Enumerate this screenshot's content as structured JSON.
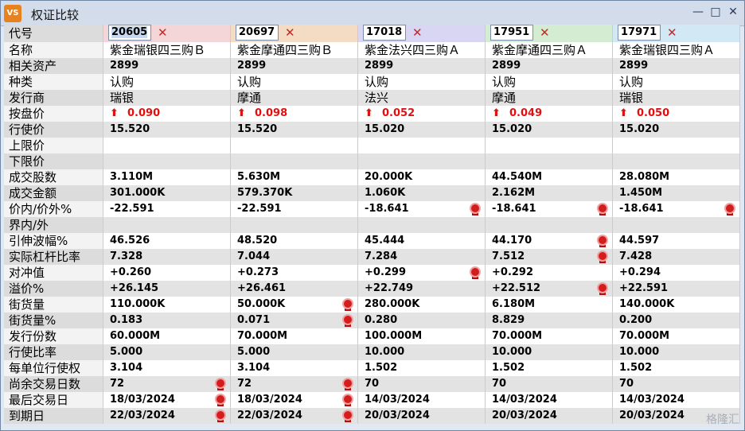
{
  "window": {
    "title": "权证比较",
    "app_icon": "VS",
    "controls": {
      "minimize": "—",
      "restore": "□",
      "close": "✕"
    }
  },
  "header": {
    "label": "代号",
    "codes": [
      "20605",
      "20697",
      "17018",
      "17951",
      "17971"
    ],
    "col_colors": [
      "#f4d6d8",
      "#f3dcc3",
      "#d8d6f2",
      "#d4ecd2",
      "#d3e8f5"
    ],
    "remove_icon": "✕"
  },
  "rows": [
    {
      "label": "名称",
      "values": [
        "紫金瑞银四三购Ｂ",
        "紫金摩通四三购Ｂ",
        "紫金法兴四三购Ａ",
        "紫金摩通四三购Ａ",
        "紫金瑞银四三购Ａ"
      ],
      "cn": true
    },
    {
      "label": "相关资产",
      "values": [
        "2899",
        "2899",
        "2899",
        "2899",
        "2899"
      ]
    },
    {
      "label": "种类",
      "values": [
        "认购",
        "认购",
        "认购",
        "认购",
        "认购"
      ],
      "cn": true
    },
    {
      "label": "发行商",
      "values": [
        "瑞银",
        "摩通",
        "法兴",
        "摩通",
        "瑞银"
      ],
      "cn": true
    },
    {
      "label": "按盘价",
      "values": [
        "0.090",
        "0.098",
        "0.052",
        "0.049",
        "0.050"
      ],
      "arrow": true
    },
    {
      "label": "行使价",
      "values": [
        "15.520",
        "15.520",
        "15.020",
        "15.020",
        "15.020"
      ]
    },
    {
      "label": "上限价",
      "values": [
        "",
        "",
        "",
        "",
        ""
      ]
    },
    {
      "label": "下限价",
      "values": [
        "",
        "",
        "",
        "",
        ""
      ]
    },
    {
      "label": "成交股数",
      "values": [
        "3.110M",
        "5.630M",
        "20.000K",
        "44.540M",
        "28.080M"
      ]
    },
    {
      "label": "成交金额",
      "values": [
        "301.000K",
        "579.370K",
        "1.060K",
        "2.162M",
        "1.450M"
      ]
    },
    {
      "label": "价内/价外%",
      "values": [
        "-22.591",
        "-22.591",
        "-18.641",
        "-18.641",
        "-18.641"
      ],
      "medals": [
        false,
        false,
        true,
        true,
        true
      ]
    },
    {
      "label": "界内/外",
      "values": [
        "",
        "",
        "",
        "",
        ""
      ]
    },
    {
      "label": "引伸波幅%",
      "values": [
        "46.526",
        "48.520",
        "45.444",
        "44.170",
        "44.597"
      ],
      "medals": [
        false,
        false,
        false,
        true,
        false
      ]
    },
    {
      "label": "实际杠杆比率",
      "values": [
        "7.328",
        "7.044",
        "7.284",
        "7.512",
        "7.428"
      ],
      "medals": [
        false,
        false,
        false,
        true,
        false
      ]
    },
    {
      "label": "对冲值",
      "values": [
        "+0.260",
        "+0.273",
        "+0.299",
        "+0.292",
        "+0.294"
      ],
      "medals": [
        false,
        false,
        true,
        false,
        false
      ]
    },
    {
      "label": "溢价%",
      "values": [
        "+26.145",
        "+26.461",
        "+22.749",
        "+22.512",
        "+22.591"
      ],
      "medals": [
        false,
        false,
        false,
        true,
        false
      ]
    },
    {
      "label": "街货量",
      "values": [
        "110.000K",
        "50.000K",
        "280.000K",
        "6.180M",
        "140.000K"
      ],
      "medals": [
        false,
        true,
        false,
        false,
        false
      ]
    },
    {
      "label": "街货量%",
      "values": [
        "0.183",
        "0.071",
        "0.280",
        "8.829",
        "0.200"
      ],
      "medals": [
        false,
        true,
        false,
        false,
        false
      ]
    },
    {
      "label": "发行份数",
      "values": [
        "60.000M",
        "70.000M",
        "100.000M",
        "70.000M",
        "70.000M"
      ]
    },
    {
      "label": "行使比率",
      "values": [
        "5.000",
        "5.000",
        "10.000",
        "10.000",
        "10.000"
      ]
    },
    {
      "label": "每单位行使权",
      "values": [
        "3.104",
        "3.104",
        "1.502",
        "1.502",
        "1.502"
      ]
    },
    {
      "label": "尚余交易日数",
      "values": [
        "72",
        "72",
        "70",
        "70",
        "70"
      ],
      "medals": [
        true,
        true,
        false,
        false,
        false
      ]
    },
    {
      "label": "最后交易日",
      "values": [
        "18/03/2024",
        "18/03/2024",
        "14/03/2024",
        "14/03/2024",
        "14/03/2024"
      ],
      "medals": [
        true,
        true,
        false,
        false,
        false
      ]
    },
    {
      "label": "到期日",
      "values": [
        "22/03/2024",
        "22/03/2024",
        "20/03/2024",
        "20/03/2024",
        "20/03/2024"
      ],
      "medals": [
        true,
        true,
        false,
        false,
        false
      ]
    }
  ],
  "icons": {
    "up_arrow": "up-arrow-icon",
    "medal": "award-ribbon-icon"
  },
  "colors": {
    "up": "#e01010",
    "medal": "#d41e1e",
    "remove": "#d42020"
  },
  "watermark": "格隆汇"
}
